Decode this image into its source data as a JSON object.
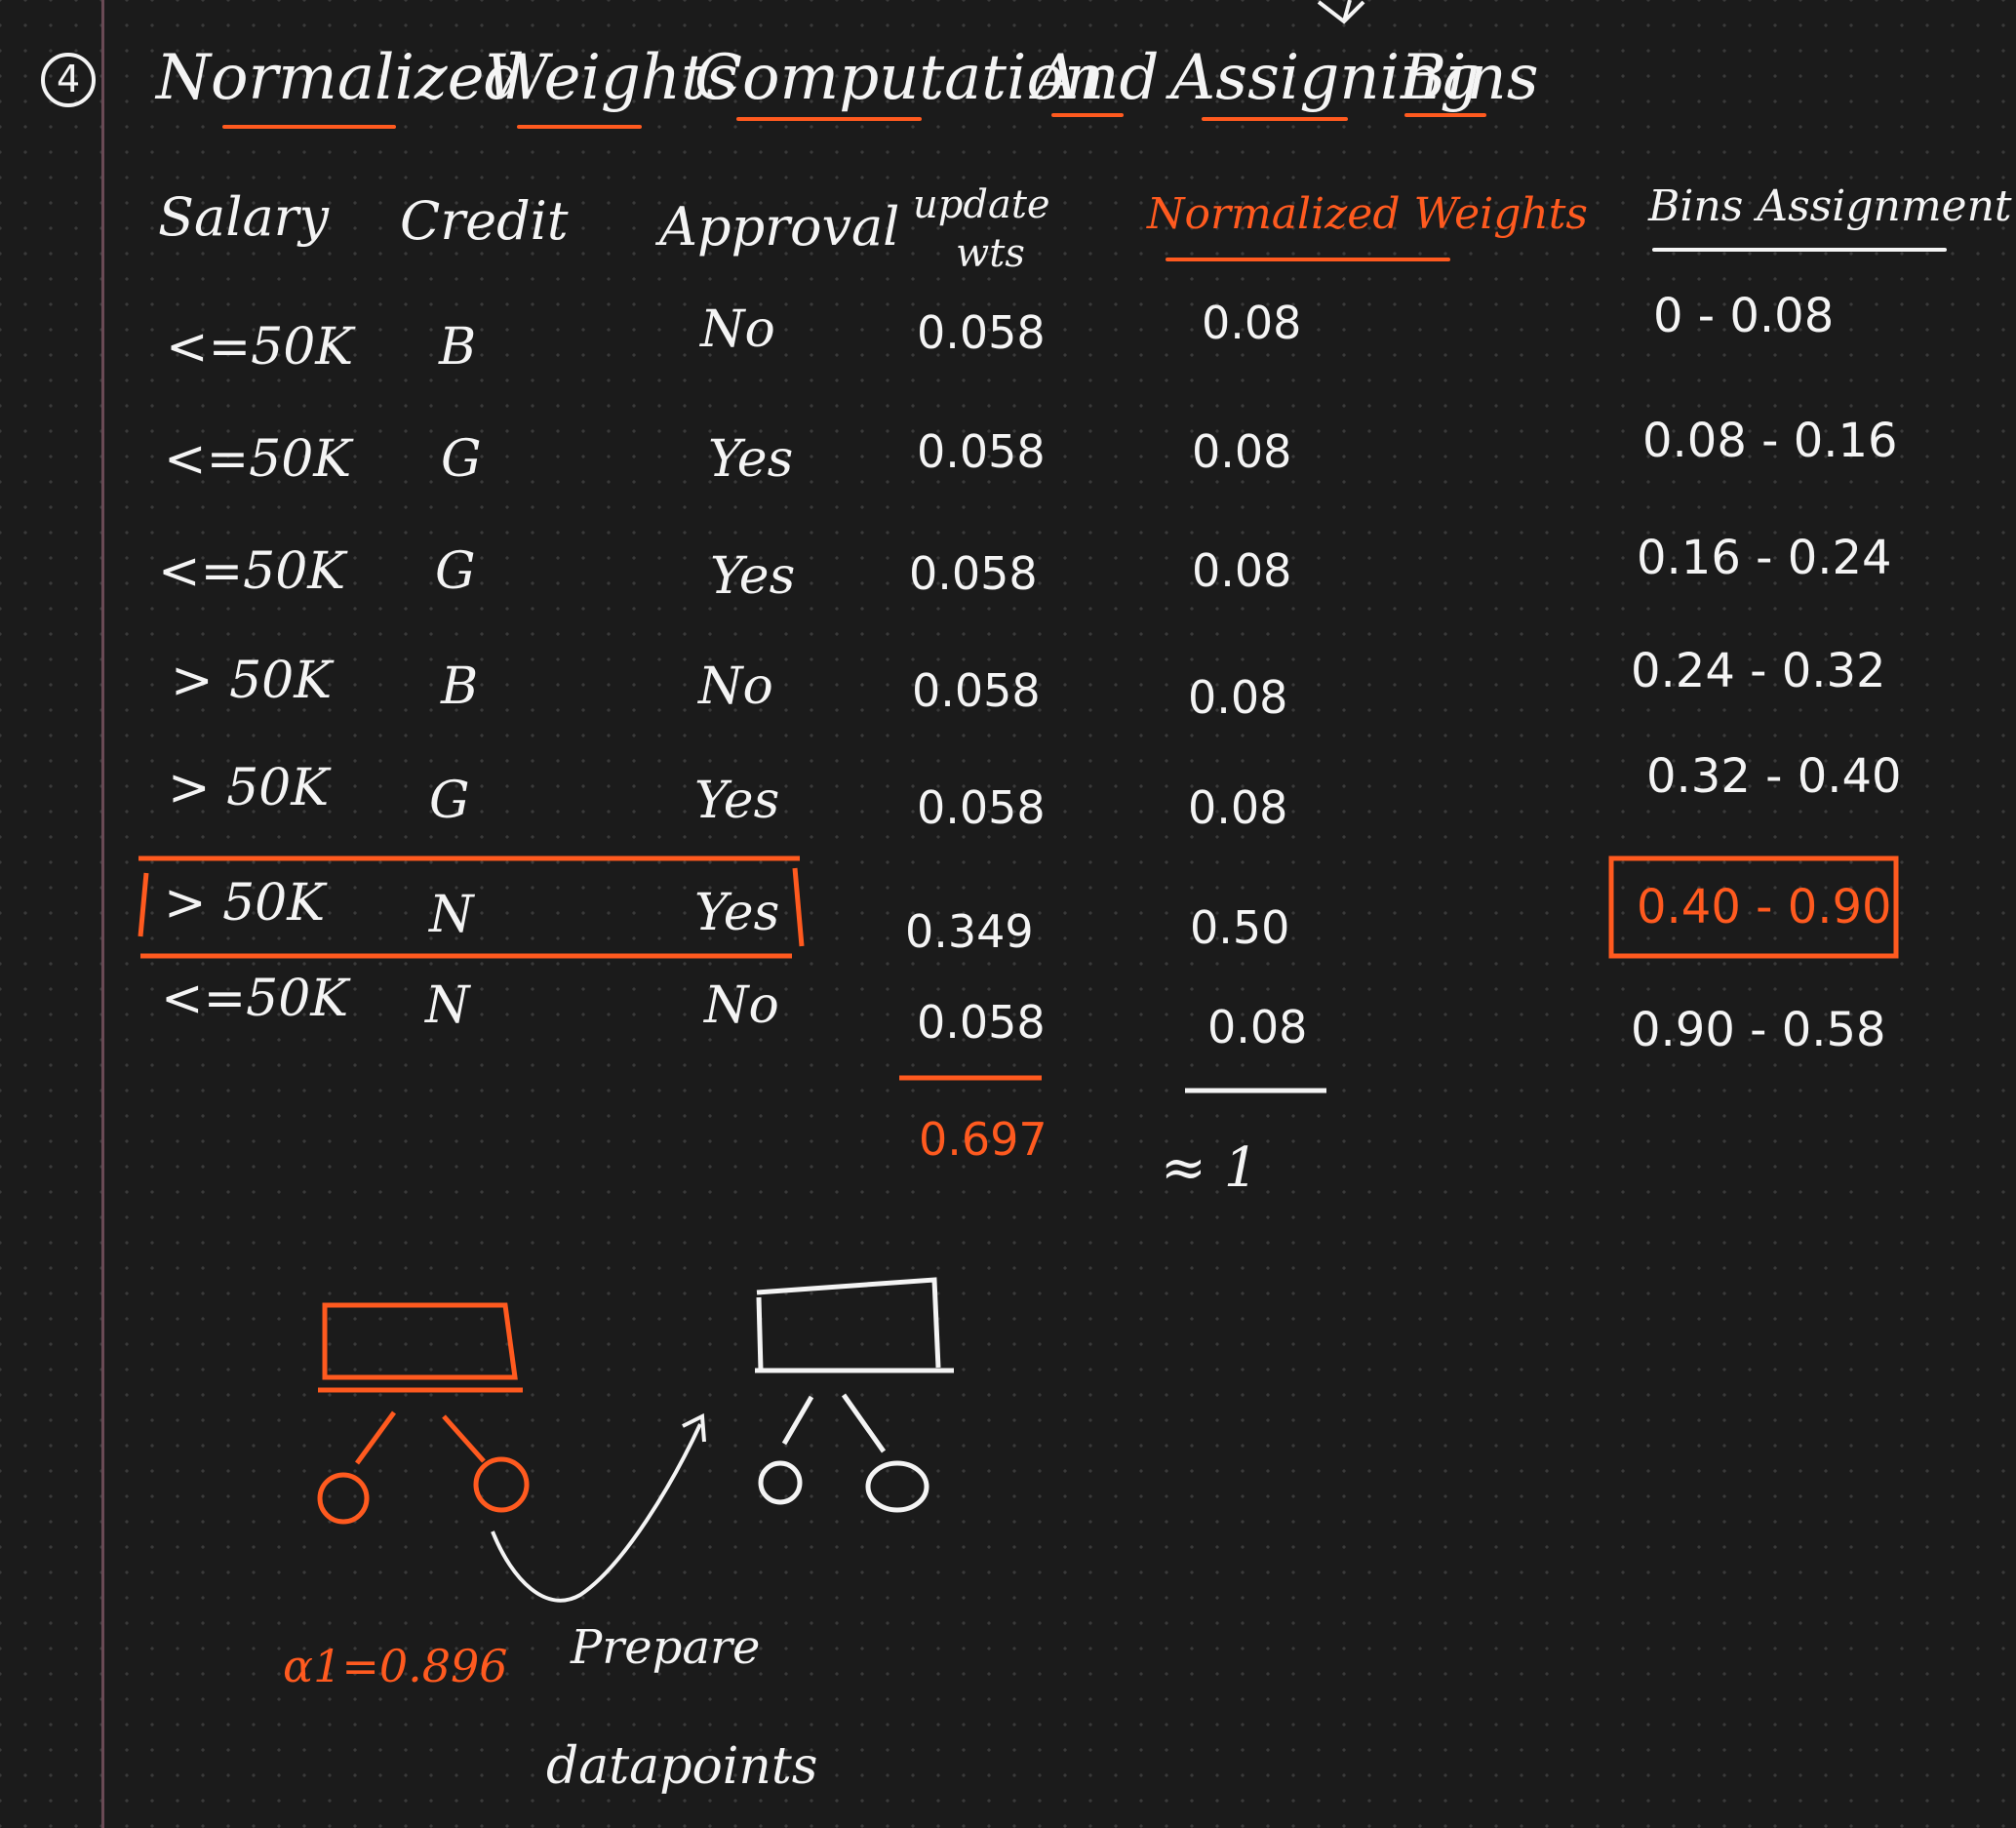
{
  "section_number": "4",
  "title_words": [
    "Normalized",
    "Weights",
    "Computation",
    "And",
    "Assigning",
    "Bins"
  ],
  "headers": {
    "salary": "Salary",
    "credit": "Credit",
    "approval": "Approval",
    "update_wts_line1": "update",
    "update_wts_line2": "wts",
    "normalized_weights": "Normalized Weights",
    "bins_assignment": "Bins Assignment"
  },
  "rows": [
    {
      "salary": "<=50K",
      "credit": "B",
      "approval": "No",
      "update_wts": "0.058",
      "normalized": "0.08",
      "bin": "0 - 0.08"
    },
    {
      "salary": "<=50K",
      "credit": "G",
      "approval": "Yes",
      "update_wts": "0.058",
      "normalized": "0.08",
      "bin": "0.08 - 0.16"
    },
    {
      "salary": "<=50K",
      "credit": "G",
      "approval": "Yes",
      "update_wts": "0.058",
      "normalized": "0.08",
      "bin": "0.16 - 0.24"
    },
    {
      "salary": "> 50K",
      "credit": "B",
      "approval": "No",
      "update_wts": "0.058",
      "normalized": "0.08",
      "bin": "0.24 - 0.32"
    },
    {
      "salary": "> 50K",
      "credit": "G",
      "approval": "Yes",
      "update_wts": "0.058",
      "normalized": "0.08",
      "bin": "0.32 - 0.40"
    },
    {
      "salary": "> 50K",
      "credit": "N",
      "approval": "Yes",
      "update_wts": "0.349",
      "normalized": "0.50",
      "bin": "0.40 - 0.90",
      "highlighted": true
    },
    {
      "salary": "<=50K",
      "credit": "N",
      "approval": "No",
      "update_wts": "0.058",
      "normalized": "0.08",
      "bin": "0.90 - 0.58"
    }
  ],
  "sum_update_wts": "0.697",
  "sum_normalized": "≈ 1",
  "alpha_label": "α1=0.896",
  "prepare_line1": "Prepare",
  "prepare_line2": "datapoints",
  "colors": {
    "accent": "#ff5a1f",
    "ink": "#f4f4f4",
    "background": "#1b1b1b"
  }
}
